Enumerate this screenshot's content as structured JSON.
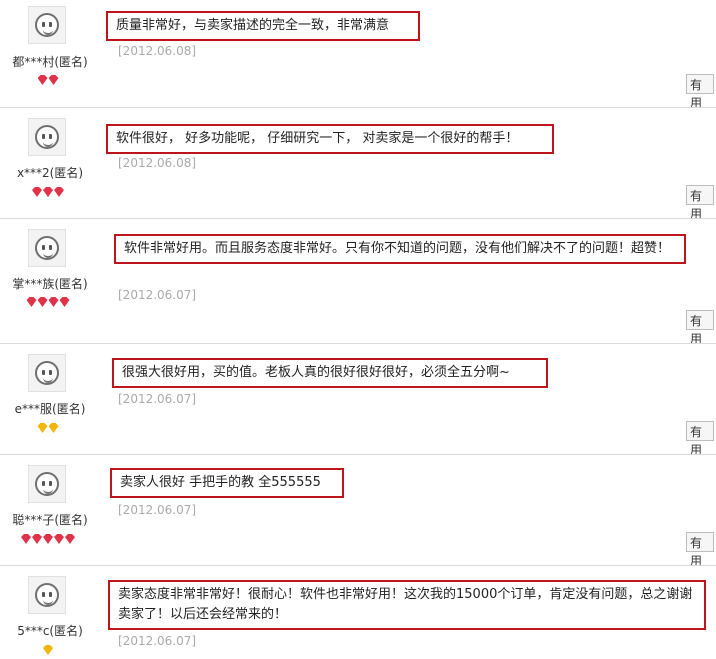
{
  "reviews": [
    {
      "user": "都***村(匿名)",
      "rank_color": "red",
      "rank_count": 2,
      "text": "质量非常好，与卖家描述的完全一致，非常满意",
      "date": "[2012.06.08]",
      "helpful_label": "有用"
    },
    {
      "user": "x***2(匿名)",
      "rank_color": "red",
      "rank_count": 3,
      "text": "软件很好， 好多功能呢， 仔细研究一下， 对卖家是一个很好的帮手！",
      "date": "[2012.06.08]",
      "helpful_label": "有用"
    },
    {
      "user": "掌***族(匿名)",
      "rank_color": "red",
      "rank_count": 4,
      "text": "软件非常好用。而且服务态度非常好。只有你不知道的问题，没有他们解决不了的问题！超赞！",
      "date": "[2012.06.07]",
      "helpful_label": "有用"
    },
    {
      "user": "e***服(匿名)",
      "rank_color": "gold",
      "rank_count": 2,
      "text": "很强大很好用，买的值。老板人真的很好很好很好，必须全五分啊~",
      "date": "[2012.06.07]",
      "helpful_label": "有用"
    },
    {
      "user": "聪***子(匿名)",
      "rank_color": "red",
      "rank_count": 5,
      "text": "卖家人很好 手把手的教 全555555",
      "date": "[2012.06.07]",
      "helpful_label": "有用"
    },
    {
      "user": "5***c(匿名)",
      "rank_color": "gold",
      "rank_count": 1,
      "text": "卖家态度非常非常好！很耐心！软件也非常好用！这次我的15000个订单，肯定没有问题，总之谢谢卖家了！以后还会经常来的！",
      "date": "[2012.06.07]",
      "helpful_label": "有用"
    }
  ]
}
